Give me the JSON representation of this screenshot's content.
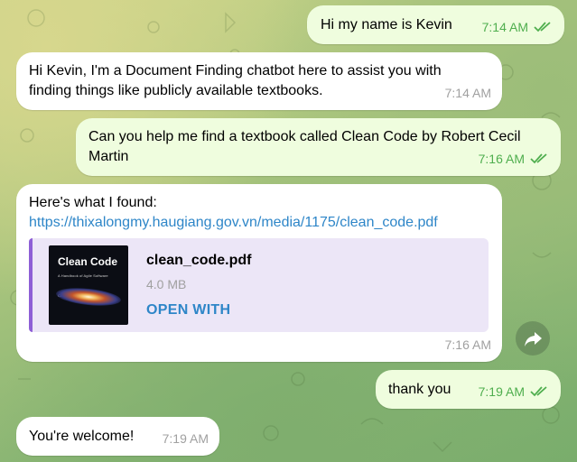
{
  "chat": {
    "messages": [
      {
        "direction": "outgoing",
        "text": "Hi my name is Kevin",
        "time": "7:14 AM"
      },
      {
        "direction": "incoming",
        "text": "Hi Kevin, I'm a Document Finding chatbot here to assist you with finding things like publicly available textbooks.",
        "time": "7:14 AM"
      },
      {
        "direction": "outgoing",
        "text": "Can you help me find a textbook called Clean Code by Robert Cecil Martin",
        "time": "7:16 AM"
      },
      {
        "direction": "incoming",
        "text": "Here's what I found:",
        "link": "https://thixalongmy.haugiang.gov.vn/media/1175/clean_code.pdf",
        "attachment": {
          "cover_title": "Clean Code",
          "cover_subtitle": "A Handbook of Agile Software Craftsmanship",
          "file_name": "clean_code.pdf",
          "file_size": "4.0 MB",
          "action": "OPEN WITH"
        },
        "time": "7:16 AM"
      },
      {
        "direction": "outgoing",
        "text": "thank you",
        "time": "7:19 AM"
      },
      {
        "direction": "incoming",
        "text": "You're welcome!",
        "time": "7:19 AM"
      }
    ],
    "icons": {
      "read_receipt": "double-check-icon",
      "share": "share-forward-icon"
    },
    "colors": {
      "outgoing_bubble": "#effdde",
      "incoming_bubble": "#ffffff",
      "outgoing_time": "#4fae4e",
      "link": "#2e86c8",
      "attachment_accent": "#8e5fd6"
    }
  }
}
